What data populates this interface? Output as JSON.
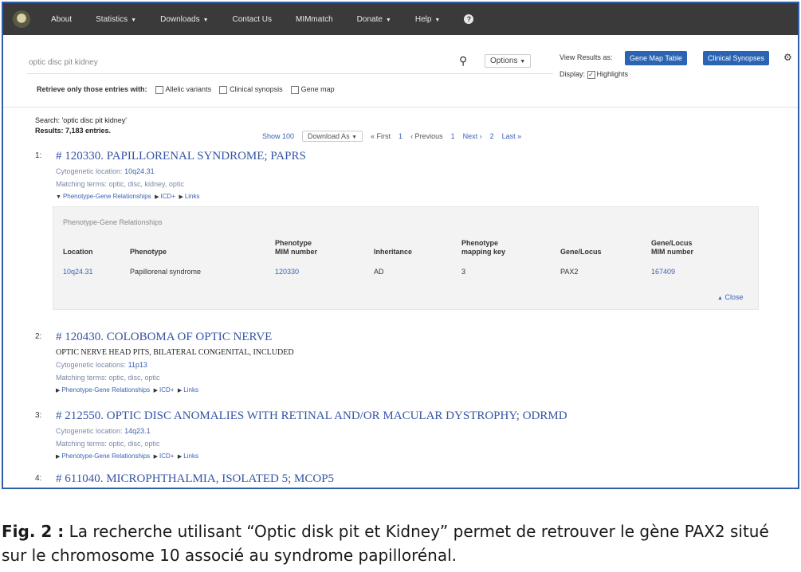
{
  "nav": {
    "items": [
      "About",
      "Statistics",
      "Downloads",
      "Contact Us",
      "MIMmatch",
      "Donate",
      "Help"
    ],
    "has_caret": [
      false,
      true,
      true,
      false,
      false,
      true,
      true
    ]
  },
  "search": {
    "query": "optic disc pit kidney",
    "options_label": "Options",
    "filter_label": "Retrieve only those entries with:",
    "filters": [
      "Allelic variants",
      "Clinical synopsis",
      "Gene map"
    ],
    "view_results_label": "View Results as:",
    "view_btn_1": "Gene Map Table",
    "view_btn_2": "Clinical Synopses",
    "display_label": "Display:",
    "highlights_label": "Highlights"
  },
  "results": {
    "search_line": "Search: 'optic disc pit kidney'",
    "count_line": "Results: 7,183 entries.",
    "show_label": "Show 100",
    "download_label": "Download As",
    "first": "« First",
    "previous": "‹ Previous",
    "page1": "1",
    "next": "Next ›",
    "page2": "2",
    "last": "Last »"
  },
  "entries": [
    {
      "num": "1:",
      "title": "# 120330. PAPILLORENAL SYNDROME; PAPRS",
      "alt": "",
      "cyto_label": "Cytogenetic location:",
      "cyto": "10q24.31",
      "matching": "Matching terms: optic, disc, kidney, optic",
      "links": [
        "Phenotype-Gene Relationships",
        "ICD+",
        "Links"
      ]
    },
    {
      "num": "2:",
      "title": "# 120430. COLOBOMA OF OPTIC NERVE",
      "alt": "OPTIC NERVE HEAD PITS, BILATERAL CONGENITAL, INCLUDED",
      "cyto_label": "Cytogenetic locations:",
      "cyto": "11p13",
      "matching": "Matching terms: optic, disc, optic",
      "links": [
        "Phenotype-Gene Relationships",
        "ICD+",
        "Links"
      ]
    },
    {
      "num": "3:",
      "title": "# 212550. OPTIC DISC ANOMALIES WITH RETINAL AND/OR MACULAR DYSTROPHY; ODRMD",
      "alt": "",
      "cyto_label": "Cytogenetic location:",
      "cyto": "14q23.1",
      "matching": "Matching terms: optic, disc, optic",
      "links": [
        "Phenotype-Gene Relationships",
        "ICD+",
        "Links"
      ]
    },
    {
      "num": "4:",
      "title": "# 611040. MICROPHTHALMIA, ISOLATED 5; MCOP5",
      "alt": "",
      "cyto_label": "",
      "cyto": "",
      "matching": "",
      "links": []
    }
  ],
  "pgr": {
    "title": "Phenotype-Gene Relationships",
    "headers": [
      "Location",
      "Phenotype",
      "Phenotype\nMIM number",
      "Inheritance",
      "Phenotype\nmapping key",
      "Gene/Locus",
      "Gene/Locus\nMIM number"
    ],
    "row": [
      "10q24.31",
      "Papillorenal syndrome",
      "120330",
      "AD",
      "3",
      "PAX2",
      "167409"
    ],
    "close": "Close"
  },
  "caption": {
    "label": "Fig. 2 :",
    "text": " La recherche utilisant “Optic disk pit et Kidney” permet de retrouver le gène PAX2 situé sur le chromosome 10 associé au syndrome papillorénal."
  }
}
